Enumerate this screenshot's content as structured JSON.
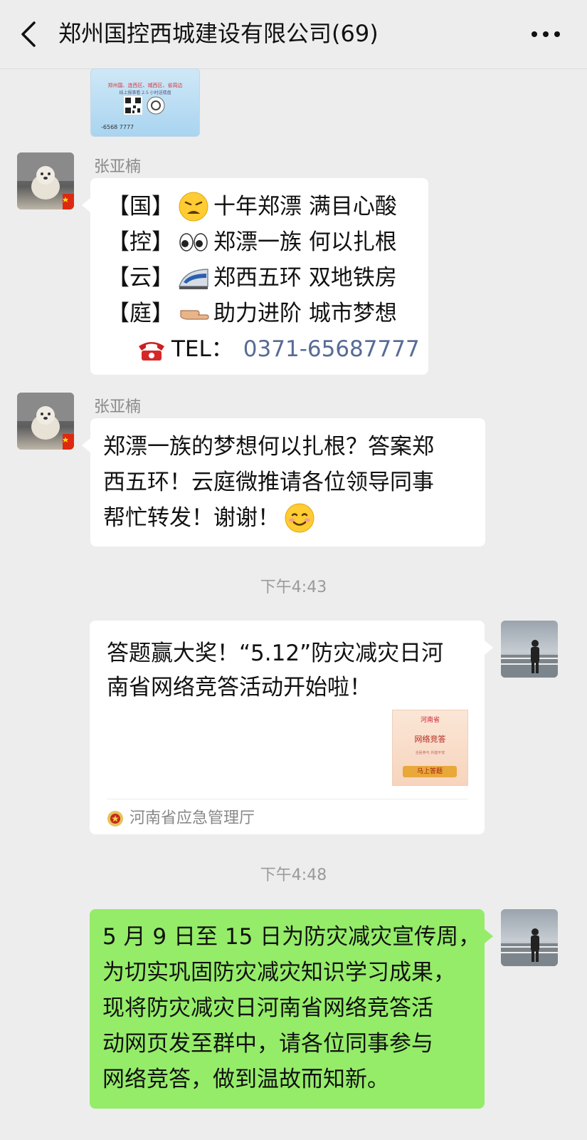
{
  "header": {
    "title": "郑州国控西城建设有限公司(69)",
    "back_icon": "chevron-left-icon",
    "more_icon": "more-dots-icon"
  },
  "top_image": {
    "text_line1": "郑州国、连西区、城西区、省周边",
    "text_line2": "线上报事看 2.5 小时送楼盘",
    "phone": "-6568 7777"
  },
  "messages": [
    {
      "sender": "张亚楠",
      "lines": [
        {
          "bracket": "【国】",
          "emoji": "weary-face-emoji",
          "text": "十年郑漂 满目心酸"
        },
        {
          "bracket": "【控】",
          "emoji": "eyes-emoji",
          "text": "郑漂一族 何以扎根"
        },
        {
          "bracket": "【云】",
          "emoji": "bullet-train-emoji",
          "text": "郑西五环 双地铁房"
        },
        {
          "bracket": "【庭】",
          "emoji": "pointing-right-emoji",
          "text": "助力进阶 城市梦想"
        }
      ],
      "tel_label": "TEL：",
      "tel_number": "0371-65687777"
    },
    {
      "sender": "张亚楠",
      "text_line1": "郑漂一族的梦想何以扎根？答案郑",
      "text_line2": "西五环！云庭微推请各位领导同事",
      "text_line3": "帮忙转发！谢谢！"
    }
  ],
  "time1": "下午4:43",
  "link_card": {
    "title_line1": "答题赢大奖！“5.12”防灾减灾日河",
    "title_line2": "南省网络竞答活动开始啦！",
    "thumb_top": "河南省",
    "thumb_title": "网络竞答",
    "thumb_sub": "全民参与 共建平安",
    "thumb_button": "马上答题",
    "source": "河南省应急管理厅"
  },
  "time2": "下午4:48",
  "green_message": {
    "line1": "5 月 9 日至 15 日为防灾减灾宣传周，",
    "line2": "为切实巩固防灾减灾知识学习成果，",
    "line3": "现将防灾减灾日河南省网络竞答活",
    "line4": "动网页发至群中，请各位同事参与",
    "line5": "网络竞答，做到温故而知新。"
  },
  "colors": {
    "background": "#ededed",
    "bubble_white": "#ffffff",
    "bubble_green": "#95ec69",
    "link_blue": "#576b95",
    "timestamp": "#9a9a9a"
  }
}
